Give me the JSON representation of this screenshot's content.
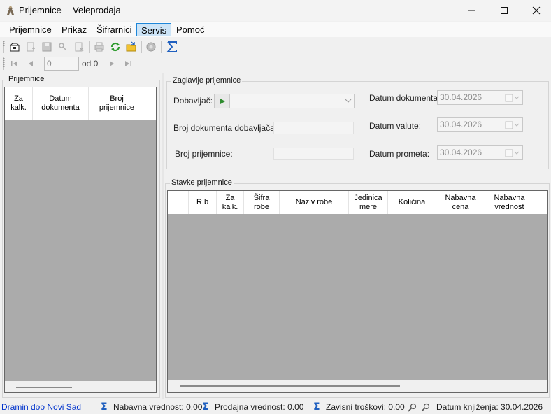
{
  "titlebar": {
    "app_title": "Prijemnice",
    "module": "Veleprodaja"
  },
  "menu": [
    "Prijemnice",
    "Prikaz",
    "Šifrarnici",
    "Servis",
    "Pomoć"
  ],
  "menu_active_index": 3,
  "navigator": {
    "position": "0",
    "of_label": "od 0"
  },
  "left_panel": {
    "title": "Prijemnice",
    "columns": [
      "Za\nkalk.",
      "Datum\ndokumenta",
      "Broj\nprijemnice"
    ]
  },
  "header_panel": {
    "title": "Zaglavlje prijemnice",
    "supplier_label": "Dobavljač:",
    "supplier_doc_label": "Broj dokumenta dobavljača:",
    "receipt_no_label": "Broj prijemnice:",
    "doc_date_label": "Datum dokumenta:",
    "doc_date_value": "30.04.2026",
    "value_date_label": "Datum valute:",
    "value_date_value": "30.04.2026",
    "turnover_date_label": "Datum prometa:",
    "turnover_date_value": "30.04.2026"
  },
  "items_panel": {
    "title": "Stavke prijemnice",
    "columns": [
      "R.b",
      "Za\nkalk.",
      "Šifra\nrobe",
      "Naziv robe",
      "Jedinica\nmere",
      "Količina",
      "Nabavna\ncena",
      "Nabavna\nvrednost"
    ]
  },
  "statusbar": {
    "company": "Dramin doo Novi Sad",
    "purchase_value": "Nabavna vrednost: 0.00",
    "sale_value": "Prodajna vrednost: 0.00",
    "dependent_costs": "Zavisni troškovi: 0.00",
    "posting_date": "Datum knjiženja: 30.04.2026"
  },
  "colors": {
    "accent": "#1e86d8",
    "grid_bg": "#ababab",
    "sigma": "#1f5fbf",
    "link": "#0033cc"
  }
}
